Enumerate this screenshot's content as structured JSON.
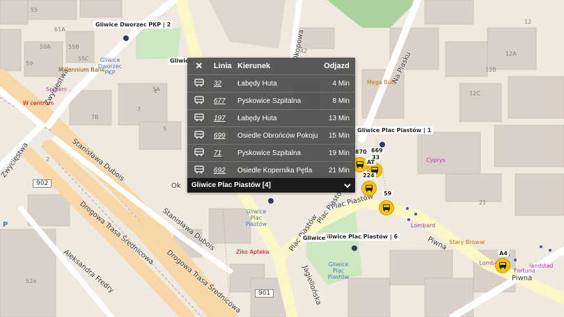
{
  "popup": {
    "close_label": "✕",
    "headers": {
      "line": "Linia",
      "direction": "Kierunek",
      "departure": "Odjazd"
    },
    "rows": [
      {
        "line": "32",
        "direction": "Łabędy Huta",
        "time": "4 Min"
      },
      {
        "line": "677",
        "direction": "Pyskowice Szpitalna",
        "time": "8 Min"
      },
      {
        "line": "197",
        "direction": "Łabędy Huta",
        "time": "13 Min"
      },
      {
        "line": "699",
        "direction": "Osiedle Obrońców Pokoju",
        "time": "15 Min"
      },
      {
        "line": "71",
        "direction": "Pyskowice Szpitalna",
        "time": "19 Min"
      },
      {
        "line": "692",
        "direction": "Osiedle Kopernika Pętla",
        "time": "21 Min"
      }
    ],
    "footer_title": "Gliwice Plac Piastów [4]",
    "chevron": "⌄"
  },
  "stops": {
    "dworzec_pkp": "Gliwice Dworzec PKP | 2",
    "plac_piastow_1": "Gliwice Plac Piastów | 1",
    "plac_piastow_6": "Gliwice Plac Piastów | 6",
    "gliwice_partial_1": "Gliwice",
    "gliwice_partial_2": "Gliwice"
  },
  "streets": {
    "zwyciestwa_1": "Zwycięstwa",
    "zwyciestwa_2": "Zwycięstwa",
    "dubois_1": "Stanisława Dubois",
    "dubois_2": "Stanisława Dubois",
    "drogowa_1": "Drogowa Trasa Średnicowa",
    "drogowa_2": "Drogowa Trasa Średnicowa",
    "fredry": "Aleksandra Fredry",
    "okopowa": "Okopowa",
    "na_piasku": "Na Piasku",
    "plac_piastow_street": "Plac Piastów",
    "plac_piastow_street2": "Plac Piastów",
    "plac_piastow_street3": "Plac Piastów",
    "pl_partial": "Pl",
    "pl_partial2": "Pl",
    "jagiellonska": "Jagiellońska",
    "piwna_1": "Piwna",
    "piwna_2": "Piwna",
    "ok_partial": "Ok"
  },
  "road_refs": {
    "r902": "902",
    "r901": "901"
  },
  "pois": {
    "millennium": "Millennium Bank",
    "spolem": "Społem",
    "w_centrum": "W centrum",
    "mega_bula": "Mega Buła",
    "cyprys": "Cyprys",
    "lombard_1": "Lombard",
    "lombard_2": "Lombard",
    "stary_browar": "Stary Browar",
    "fortuna": "Fortuna",
    "landstad": "landstad",
    "ziko": "Ziko Apteka",
    "stop_label_dworzec": "Gliwice Dworzec PKP",
    "stop_label_piastow_a": "Gliwice Plac Piastów",
    "stop_label_piastow_b": "Gliwice Plac Piastów",
    "parking": "P"
  },
  "house_numbers": [
    "61A",
    "59A",
    "59",
    "55",
    "55B",
    "55C",
    "5A",
    "7",
    "7B",
    "5",
    "6",
    "8",
    "7A",
    "3",
    "3A",
    "1",
    "7B",
    "9",
    "2",
    "4",
    "2",
    "54",
    "52",
    "50",
    "42",
    "42",
    "12",
    "12A",
    "12B",
    "12C",
    "7",
    "5",
    "1",
    "52a",
    "21",
    "1",
    "2",
    "8"
  ],
  "route_badges": [
    "870",
    "669",
    "33",
    "224",
    "59",
    "A4",
    "AT"
  ]
}
